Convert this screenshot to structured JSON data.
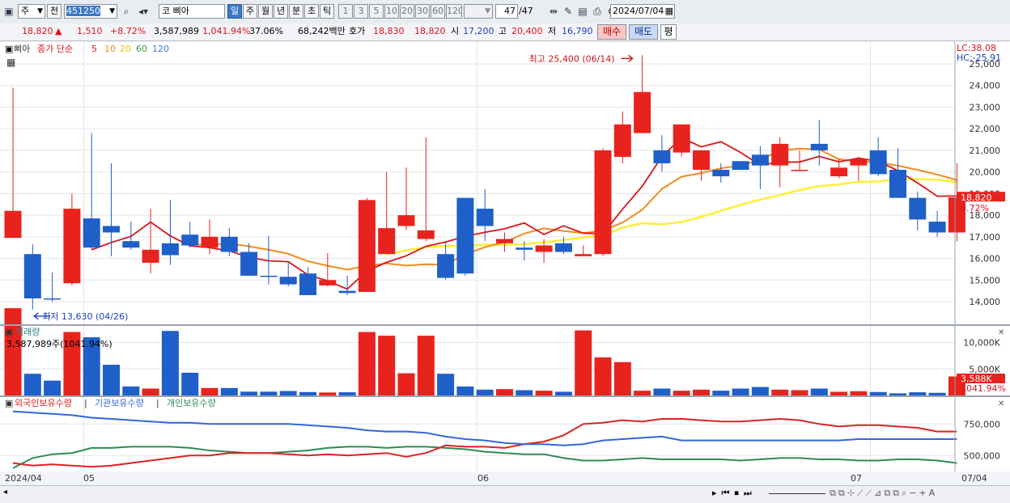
{
  "toolbar": {
    "mode": "주",
    "prev_label": "전",
    "code": "451250",
    "market": "코",
    "name": "삐아",
    "periods": [
      "일",
      "주",
      "월",
      "년",
      "분",
      "초",
      "틱"
    ],
    "minute_units": [
      "1",
      "3",
      "5",
      "10",
      "20",
      "30",
      "60",
      "120"
    ],
    "page_count": "47",
    "page_total": "/47",
    "date": "2024/07/04"
  },
  "quote": {
    "price": "18,820",
    "change_arrow": "▲",
    "change": "1,510",
    "change_pct": "+8.72%",
    "volume": "3,587,989",
    "volume_ratio": "1,041.94%",
    "turnover": "37.06%",
    "amount": "68,242백만",
    "ask_label": "호가",
    "ask": "18,830",
    "bid": "18,820",
    "open_label": "시",
    "open": "17,200",
    "high_label": "고",
    "high": "20,400",
    "low_label": "저",
    "low": "16,790",
    "buy_label": "매수",
    "sell_label": "매도",
    "eval_label": "평"
  },
  "price_panel": {
    "legend_name": "삐아",
    "legend_title": "종가 단순",
    "ma_labels": [
      "5",
      "10",
      "20",
      "60",
      "120"
    ],
    "lc": "LC:38.08",
    "hc": "HC:-25.91",
    "max_label": "최고 25,400 (06/14)",
    "min_label": "최저 13,630 (04/26)",
    "current_label": "18,820",
    "current_pct": "8.72%"
  },
  "volume_panel": {
    "title": "거래량",
    "subtitle": "3,587,989주(1041.94%)",
    "current_label": "3,588K",
    "current_pct": "1041.94%"
  },
  "holding_panel": {
    "legend": [
      "외국인보유수량",
      "기관보유수량",
      "개인보유수량"
    ]
  },
  "x_axis": {
    "labels": [
      "2024/04",
      "05",
      "06",
      "07",
      "07/04"
    ]
  },
  "colors": {
    "up": "#e8231d",
    "down": "#1f5fc9",
    "ma5": "#d9141b",
    "ma10": "#f08c1e",
    "ma20": "#ffee33",
    "ma60": "#3a9a3a",
    "ma120": "#3a7fd0",
    "foreign": "#2e8b57",
    "institution": "#dd2222",
    "individual": "#3366dd"
  },
  "chart_data": [
    {
      "type": "candlestick",
      "title": "",
      "x": [
        "04/23",
        "04/24",
        "04/25",
        "04/26",
        "04/29",
        "04/30",
        "05/02",
        "05/03",
        "05/07",
        "05/08",
        "05/09",
        "05/10",
        "05/13",
        "05/14",
        "05/16",
        "05/17",
        "05/20",
        "05/21",
        "05/22",
        "05/23",
        "05/24",
        "05/27",
        "05/28",
        "05/29",
        "05/30",
        "05/31",
        "06/03",
        "06/04",
        "06/05",
        "06/07",
        "06/10",
        "06/11",
        "06/12",
        "06/13",
        "06/14",
        "06/17",
        "06/18",
        "06/19",
        "06/20",
        "06/21",
        "06/24",
        "06/25",
        "06/26",
        "06/27",
        "06/28",
        "07/01",
        "07/02",
        "07/03",
        "07/04"
      ],
      "open": [
        16950,
        16200,
        14150,
        14850,
        17850,
        17500,
        16800,
        15800,
        16700,
        17100,
        16500,
        17000,
        16300,
        15200,
        15150,
        15300,
        14750,
        14500,
        14450,
        16200,
        17500,
        16900,
        16200,
        18800,
        18300,
        16700,
        16500,
        16300,
        16700,
        16100,
        16200,
        20700,
        21800,
        21000,
        20900,
        20100,
        20100,
        20500,
        20800,
        20300,
        20100,
        21300,
        19800,
        20300,
        21000,
        20100,
        18800,
        17700,
        17200
      ],
      "close": [
        18200,
        14150,
        14100,
        18300,
        16500,
        17200,
        16500,
        16400,
        16150,
        16600,
        17000,
        16300,
        15200,
        15150,
        14800,
        14300,
        15000,
        14400,
        18700,
        17400,
        18000,
        17300,
        15100,
        15300,
        17500,
        16900,
        16400,
        16600,
        16300,
        16200,
        21000,
        22200,
        23700,
        20400,
        22200,
        21000,
        19800,
        20100,
        20300,
        21300,
        20100,
        21000,
        20200,
        20600,
        19900,
        18800,
        17800,
        17200,
        18820
      ],
      "high": [
        23900,
        16650,
        15350,
        19000,
        21800,
        20400,
        17700,
        18300,
        18700,
        17700,
        17800,
        17400,
        16700,
        17050,
        15800,
        15600,
        16250,
        15200,
        18800,
        20000,
        20200,
        21600,
        16800,
        18300,
        19200,
        17200,
        16800,
        16900,
        17000,
        16600,
        21100,
        22800,
        25400,
        21700,
        21600,
        20800,
        20400,
        20400,
        21200,
        21600,
        21000,
        22400,
        20600,
        20700,
        21600,
        21100,
        19100,
        18200,
        20400
      ],
      "low": [
        16950,
        13630,
        14000,
        14750,
        16400,
        16100,
        16400,
        15300,
        15700,
        16500,
        16200,
        16100,
        15200,
        14800,
        14700,
        14300,
        14700,
        14300,
        14450,
        16300,
        17300,
        16800,
        15000,
        15200,
        16800,
        16300,
        15900,
        15800,
        16200,
        16100,
        16100,
        20400,
        21800,
        20000,
        20700,
        19600,
        19500,
        20100,
        19200,
        19300,
        20100,
        20300,
        19700,
        19600,
        19800,
        18800,
        17300,
        17000,
        16790
      ],
      "ma5": [
        null,
        null,
        null,
        null,
        16400,
        16740,
        17020,
        17680,
        17040,
        16580,
        16500,
        16350,
        16050,
        15890,
        15850,
        15240,
        14960,
        14580,
        15420,
        15820,
        16120,
        16560,
        16760,
        17020,
        17210,
        17370,
        17640,
        17110,
        17510,
        17170,
        17140,
        18280,
        19340,
        20720,
        21580,
        21160,
        21400,
        20900,
        20320,
        20450,
        20460,
        20720,
        20470,
        20640,
        20490,
        20060,
        19490,
        18880,
        18890
      ],
      "ma10": [
        null,
        null,
        null,
        null,
        null,
        null,
        null,
        null,
        null,
        16660,
        16620,
        16690,
        16560,
        16400,
        16210,
        15870,
        15660,
        15480,
        15660,
        15770,
        15670,
        15730,
        15710,
        16190,
        16520,
        16750,
        17150,
        17390,
        17270,
        17170,
        17290,
        17660,
        18250,
        19220,
        19780,
        19950,
        20170,
        20300,
        20560,
        20990,
        21080,
        21040,
        20590,
        20480,
        20450,
        20290,
        20100,
        19880,
        19630
      ],
      "ma20": [
        null,
        null,
        null,
        null,
        null,
        null,
        null,
        null,
        null,
        null,
        null,
        null,
        null,
        null,
        null,
        null,
        null,
        null,
        null,
        16190,
        16370,
        16520,
        16570,
        16590,
        16640,
        16620,
        16660,
        16740,
        16850,
        16970,
        17040,
        17430,
        17630,
        17580,
        17680,
        17930,
        18200,
        18480,
        18720,
        18930,
        19160,
        19350,
        19420,
        19550,
        19560,
        19660,
        19670,
        19640,
        19530
      ],
      "ylim": [
        13000,
        26000
      ]
    },
    {
      "type": "bar",
      "title": "거래량",
      "x": [
        "04/23",
        "04/24",
        "04/25",
        "04/26",
        "04/29",
        "04/30",
        "05/02",
        "05/03",
        "05/07",
        "05/08",
        "05/09",
        "05/10",
        "05/13",
        "05/14",
        "05/16",
        "05/17",
        "05/20",
        "05/21",
        "05/22",
        "05/23",
        "05/24",
        "05/27",
        "05/28",
        "05/29",
        "05/30",
        "05/31",
        "06/03",
        "06/04",
        "06/05",
        "06/07",
        "06/10",
        "06/11",
        "06/12",
        "06/13",
        "06/14",
        "06/17",
        "06/18",
        "06/19",
        "06/20",
        "06/21",
        "06/24",
        "06/25",
        "06/26",
        "06/27",
        "06/28",
        "07/01",
        "07/02",
        "07/03",
        "07/04"
      ],
      "values_k": [
        16500,
        4100,
        2800,
        12000,
        11000,
        5800,
        1700,
        1300,
        12200,
        4300,
        1400,
        1400,
        720,
        720,
        840,
        640,
        560,
        600,
        12000,
        11300,
        4200,
        11300,
        4100,
        1700,
        1100,
        1200,
        1000,
        900,
        700,
        12300,
        7200,
        6300,
        900,
        1300,
        900,
        1100,
        900,
        1300,
        1600,
        1100,
        1000,
        1300,
        700,
        800,
        650,
        400,
        600,
        500,
        3588
      ],
      "ylim": [
        0,
        13000
      ]
    },
    {
      "type": "line",
      "title": "",
      "series": [
        {
          "name": "외국인보유수량",
          "values": [
            400000,
            480000,
            510000,
            520000,
            560000,
            560000,
            570000,
            570000,
            570000,
            560000,
            540000,
            530000,
            520000,
            520000,
            530000,
            540000,
            560000,
            570000,
            570000,
            560000,
            570000,
            570000,
            560000,
            550000,
            530000,
            520000,
            510000,
            510000,
            480000,
            460000,
            460000,
            470000,
            480000,
            470000,
            470000,
            470000,
            470000,
            460000,
            470000,
            480000,
            480000,
            470000,
            470000,
            460000,
            460000,
            470000,
            470000,
            460000,
            440000
          ]
        },
        {
          "name": "기관보유수량",
          "values": [
            440000,
            420000,
            430000,
            420000,
            410000,
            420000,
            440000,
            460000,
            480000,
            500000,
            500000,
            520000,
            520000,
            520000,
            510000,
            500000,
            510000,
            500000,
            510000,
            520000,
            490000,
            520000,
            580000,
            570000,
            570000,
            560000,
            590000,
            610000,
            660000,
            750000,
            760000,
            780000,
            770000,
            790000,
            790000,
            780000,
            770000,
            770000,
            780000,
            790000,
            780000,
            750000,
            730000,
            740000,
            740000,
            730000,
            720000,
            690000,
            690000
          ]
        },
        {
          "name": "개인보유수량",
          "values": [
            850000,
            840000,
            830000,
            820000,
            800000,
            790000,
            780000,
            770000,
            760000,
            760000,
            750000,
            750000,
            750000,
            750000,
            750000,
            740000,
            730000,
            720000,
            700000,
            690000,
            690000,
            680000,
            650000,
            630000,
            620000,
            600000,
            590000,
            590000,
            580000,
            590000,
            620000,
            630000,
            640000,
            650000,
            620000,
            620000,
            620000,
            620000,
            620000,
            620000,
            620000,
            620000,
            620000,
            630000,
            630000,
            630000,
            630000,
            630000,
            630000
          ]
        }
      ]
    }
  ]
}
